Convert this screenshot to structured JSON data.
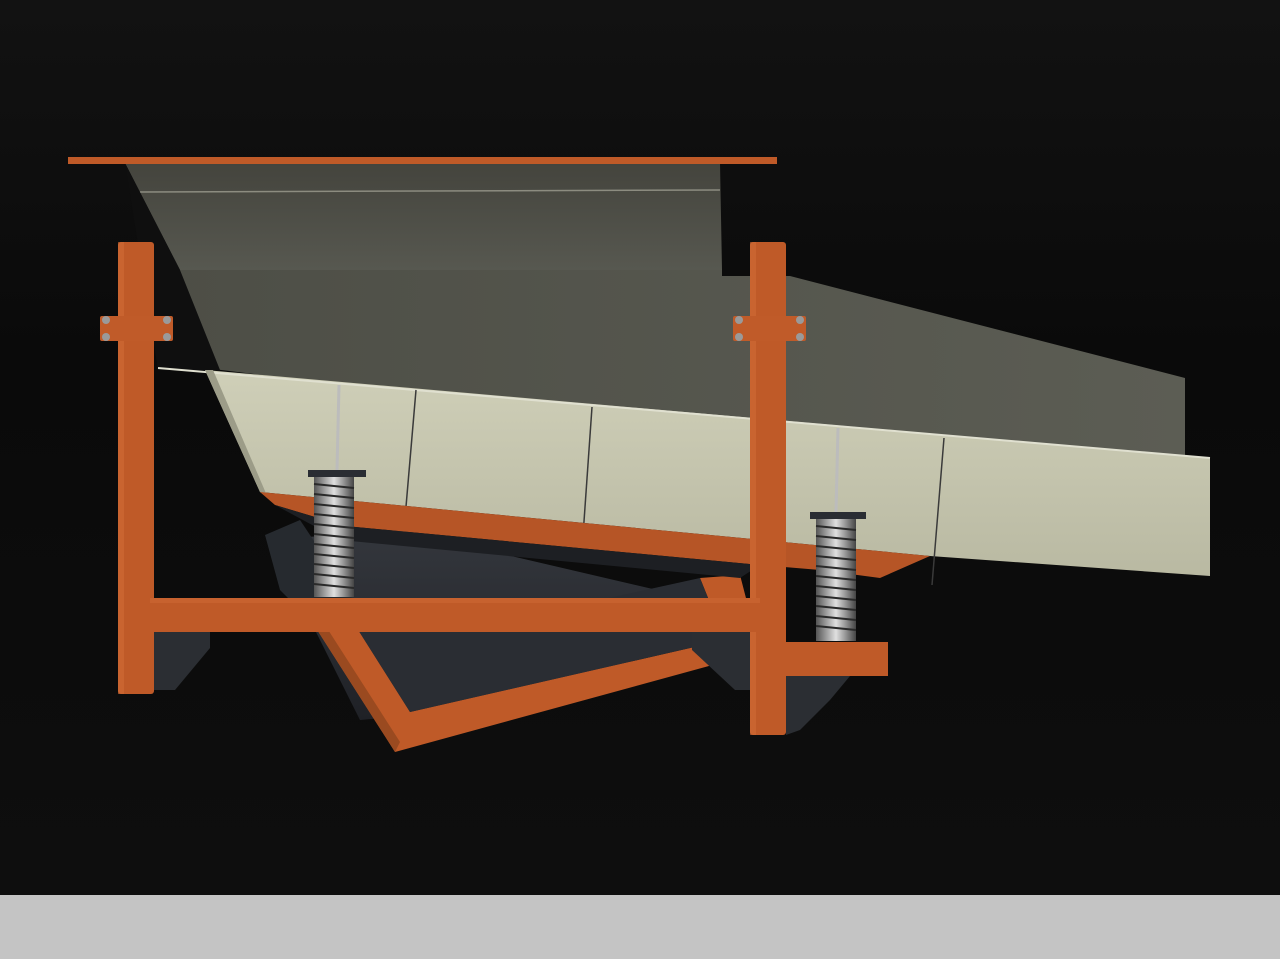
{
  "scene": {
    "subject": "vibrating-feeder-model",
    "colors": {
      "background": "#0d0d0d",
      "frame": "#bf5a28",
      "frame_shade": "#a94c1f",
      "hopper_back": "#4a4a42",
      "trough_liner": "#c3c3ac",
      "spring": "#8a8a8a",
      "base_plate": "#2b2e33",
      "status_bar": "#c4c4c4"
    }
  }
}
